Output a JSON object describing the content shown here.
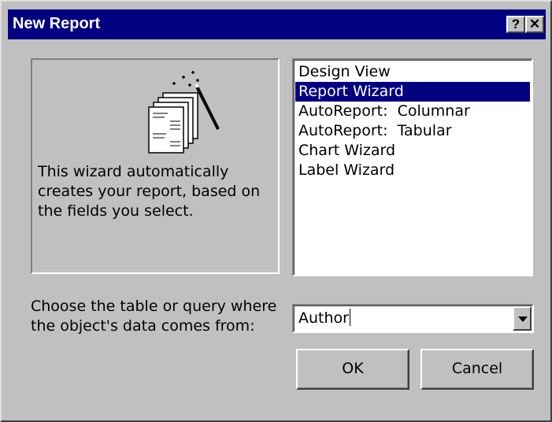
{
  "window": {
    "title": "New Report",
    "help_label": "?",
    "close_label": "✕"
  },
  "preview": {
    "icon": "report-wizard-icon",
    "description": "This wizard automatically creates your report, based on the fields you select."
  },
  "report_types": {
    "items": [
      {
        "label": "Design View",
        "selected": false
      },
      {
        "label": "Report Wizard",
        "selected": true
      },
      {
        "label": "AutoReport:  Columnar",
        "selected": false
      },
      {
        "label": "AutoReport:  Tabular",
        "selected": false
      },
      {
        "label": "Chart Wizard",
        "selected": false
      },
      {
        "label": "Label Wizard",
        "selected": false
      }
    ]
  },
  "source": {
    "label": "Choose the table or query where the object's data comes from:",
    "value": "Author"
  },
  "buttons": {
    "ok_label": "OK",
    "cancel_label": "Cancel"
  },
  "colors": {
    "title_bar": "#000080",
    "selection": "#000080",
    "face": "#c0c0c0"
  }
}
